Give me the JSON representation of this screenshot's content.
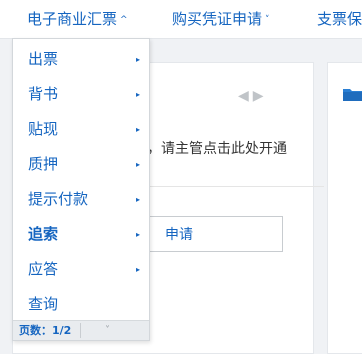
{
  "nav": [
    {
      "label": "电子商业汇票",
      "caret": "^"
    },
    {
      "label": "购买凭证申请",
      "caret": "˅"
    },
    {
      "label": "支票保"
    }
  ],
  "main": {
    "notice": "，请主管点击此处开通",
    "apply_label": "申请"
  },
  "dropdown": {
    "items": [
      {
        "label": "出票",
        "arrow": "▸"
      },
      {
        "label": "背书",
        "arrow": "▸"
      },
      {
        "label": "贴现",
        "arrow": "▸"
      },
      {
        "label": "质押",
        "arrow": "▸"
      },
      {
        "label": "提示付款",
        "arrow": "▸"
      },
      {
        "label": "追索",
        "arrow": "▸"
      },
      {
        "label": "应答",
        "arrow": "▸"
      },
      {
        "label": "查询"
      }
    ],
    "pager": {
      "text": "页数：1/2",
      "next_icon": "˅"
    }
  },
  "colors": {
    "link": "#1565c0",
    "folder": "#2a7fd4"
  }
}
